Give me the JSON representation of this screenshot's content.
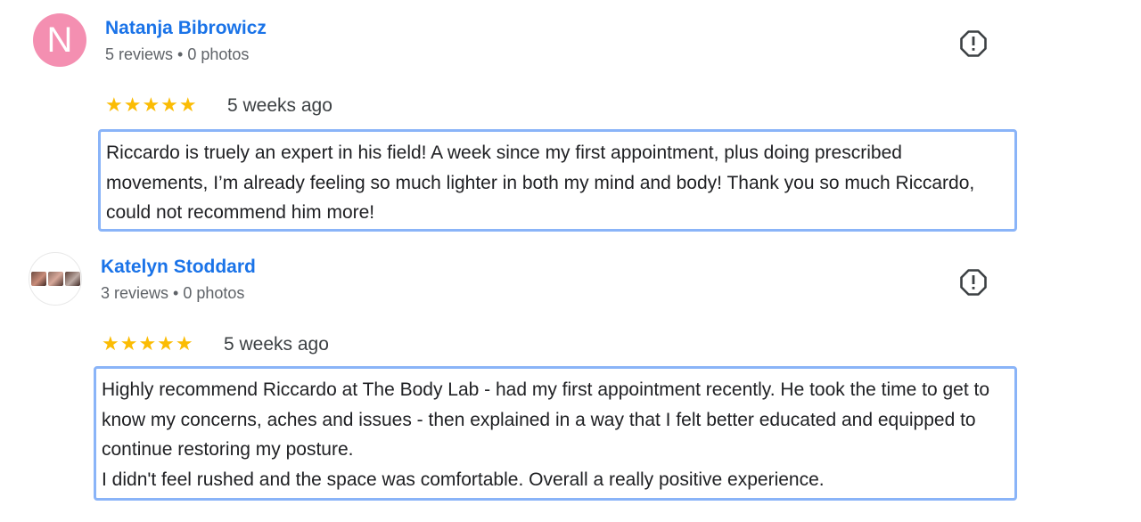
{
  "reviews": [
    {
      "avatar_letter": "N",
      "name": "Natanja Bibrowicz",
      "meta": "5 reviews • 0 photos",
      "rating": 5,
      "stars": "★★★★★",
      "time_ago": "5 weeks ago",
      "text": "Riccardo is truely an expert in his field! A week since my first appointment, plus doing prescribed movements, I’m already feeling so much lighter in both my mind and body! Thank you so much Riccardo, could not recommend him more!"
    },
    {
      "avatar_letter": "",
      "name": "Katelyn Stoddard",
      "meta": "3 reviews • 0 photos",
      "rating": 5,
      "stars": "★★★★★",
      "time_ago": "5 weeks ago",
      "text": "Highly recommend Riccardo at The Body Lab - had my first appointment recently. He took the time to get to know my concerns, aches and issues - then explained in a way that I felt better educated and equipped to continue restoring my posture.\nI didn't feel rushed and the space was comfortable. Overall a really positive experience."
    }
  ],
  "colors": {
    "name_link": "#1a73e8",
    "star": "#fbbc04",
    "highlight_border": "#8ab4f8",
    "avatar_pink": "#f48fb1"
  },
  "icons": {
    "report": "report-flag-icon"
  }
}
